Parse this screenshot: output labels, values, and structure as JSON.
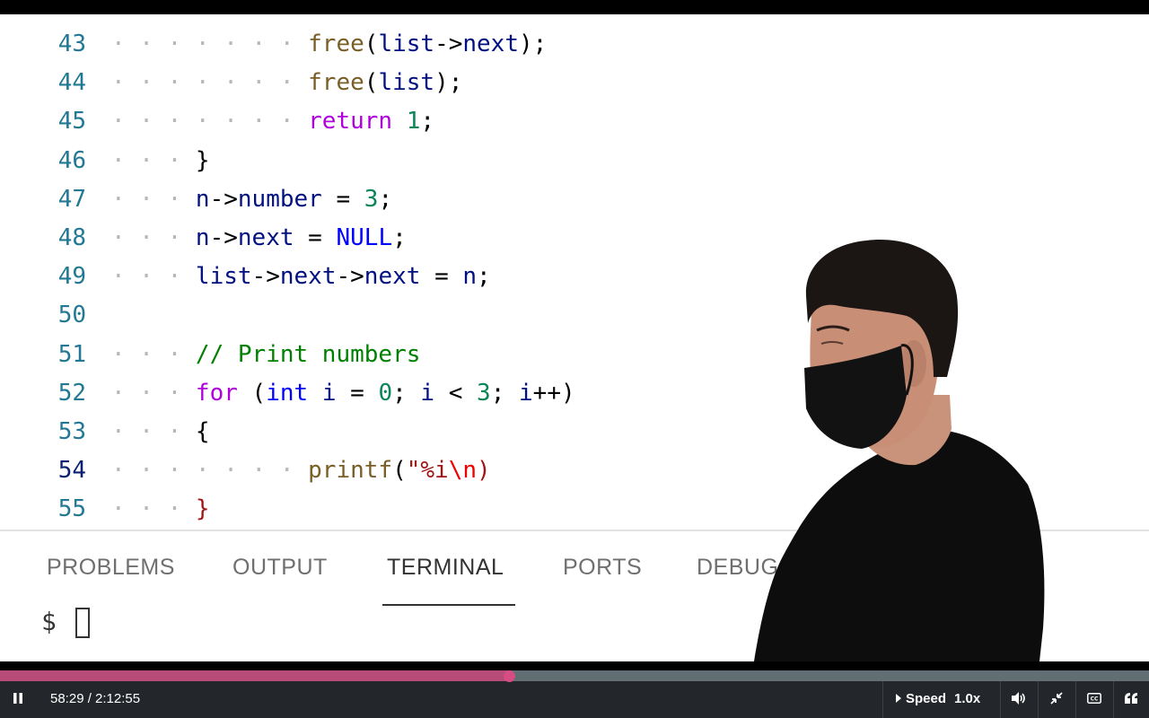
{
  "editor": {
    "lines": [
      {
        "number": "43",
        "ws": "· · · · · · · ",
        "parts": [
          [
            "fn",
            "free"
          ],
          [
            "punc",
            "("
          ],
          [
            "var",
            "list"
          ],
          [
            "punc",
            "->"
          ],
          [
            "var",
            "next"
          ],
          [
            "punc",
            ");"
          ]
        ]
      },
      {
        "number": "44",
        "ws": "· · · · · · · ",
        "parts": [
          [
            "fn",
            "free"
          ],
          [
            "punc",
            "("
          ],
          [
            "var",
            "list"
          ],
          [
            "punc",
            ");"
          ]
        ]
      },
      {
        "number": "45",
        "ws": "· · · · · · · ",
        "parts": [
          [
            "ctl",
            "return"
          ],
          [
            "punc",
            " "
          ],
          [
            "num",
            "1"
          ],
          [
            "punc",
            ";"
          ]
        ]
      },
      {
        "number": "46",
        "ws": "· · · ",
        "parts": [
          [
            "punc",
            "}"
          ]
        ]
      },
      {
        "number": "47",
        "ws": "· · · ",
        "parts": [
          [
            "var",
            "n"
          ],
          [
            "punc",
            "->"
          ],
          [
            "var",
            "number"
          ],
          [
            "punc",
            " = "
          ],
          [
            "num",
            "3"
          ],
          [
            "punc",
            ";"
          ]
        ]
      },
      {
        "number": "48",
        "ws": "· · · ",
        "parts": [
          [
            "var",
            "n"
          ],
          [
            "punc",
            "->"
          ],
          [
            "var",
            "next"
          ],
          [
            "punc",
            " = "
          ],
          [
            "kw",
            "NULL"
          ],
          [
            "punc",
            ";"
          ]
        ]
      },
      {
        "number": "49",
        "ws": "· · · ",
        "parts": [
          [
            "var",
            "list"
          ],
          [
            "punc",
            "->"
          ],
          [
            "var",
            "next"
          ],
          [
            "punc",
            "->"
          ],
          [
            "var",
            "next"
          ],
          [
            "punc",
            " = "
          ],
          [
            "var",
            "n"
          ],
          [
            "punc",
            ";"
          ]
        ]
      },
      {
        "number": "50",
        "ws": "",
        "parts": []
      },
      {
        "number": "51",
        "ws": "· · · ",
        "parts": [
          [
            "cmt",
            "// Print numbers"
          ]
        ]
      },
      {
        "number": "52",
        "ws": "· · · ",
        "parts": [
          [
            "ctl",
            "for"
          ],
          [
            "punc",
            " ("
          ],
          [
            "kw",
            "int"
          ],
          [
            "punc",
            " "
          ],
          [
            "var",
            "i"
          ],
          [
            "punc",
            " = "
          ],
          [
            "num",
            "0"
          ],
          [
            "punc",
            "; "
          ],
          [
            "var",
            "i"
          ],
          [
            "punc",
            " < "
          ],
          [
            "num",
            "3"
          ],
          [
            "punc",
            "; "
          ],
          [
            "var",
            "i"
          ],
          [
            "punc",
            "++)"
          ]
        ]
      },
      {
        "number": "53",
        "ws": "· · · ",
        "parts": [
          [
            "punc",
            "{"
          ]
        ]
      },
      {
        "number": "54",
        "ws": "· · · · · · · ",
        "active": true,
        "parts": [
          [
            "fn",
            "printf"
          ],
          [
            "punc",
            "("
          ],
          [
            "str",
            "\"%i"
          ],
          [
            "esc",
            "\\n"
          ],
          [
            "brk2",
            ")"
          ]
        ]
      },
      {
        "number": "55",
        "ws": "· · · ",
        "parts": [
          [
            "brk2",
            "}"
          ]
        ]
      }
    ]
  },
  "panel": {
    "tabs": [
      "PROBLEMS",
      "OUTPUT",
      "TERMINAL",
      "PORTS",
      "DEBUG"
    ],
    "active_tab": "TERMINAL",
    "prompt": "$"
  },
  "player": {
    "progress": 0.443,
    "current_time": "58:29",
    "duration": "2:12:55",
    "time_display": "58:29 / 2:12:55",
    "speed_label": "Speed",
    "speed_value": "1.0x",
    "accent_color": "#b74c79",
    "icons": [
      "pause-icon",
      "speed-caret-icon",
      "volume-icon",
      "exit-fullscreen-icon",
      "captions-icon",
      "transcript-icon"
    ]
  }
}
